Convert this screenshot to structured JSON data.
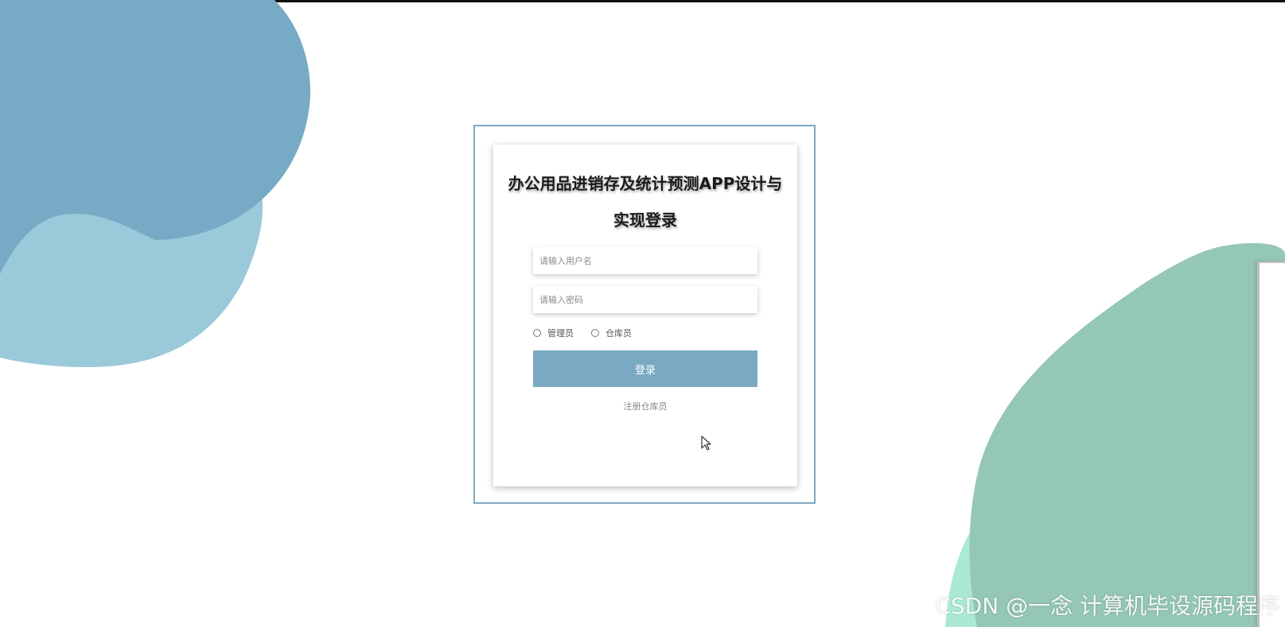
{
  "login": {
    "title": "办公用品进销存及统计预测APP设计与实现登录",
    "username_placeholder": "请输入用户名",
    "password_placeholder": "请输入密码",
    "roles": [
      "管理员",
      "仓库员"
    ],
    "login_button": "登录",
    "register_link": "注册仓库员"
  },
  "watermark": "CSDN @一念 计算机毕设源码程序",
  "colors": {
    "blob_blue_dark": "#77aac4",
    "blob_blue_light": "#9ac9d9",
    "blob_green": "#94c7b4",
    "blob_mint": "#abe8d6",
    "button": "#79a9c3",
    "frame_border": "#7fa9c2"
  }
}
